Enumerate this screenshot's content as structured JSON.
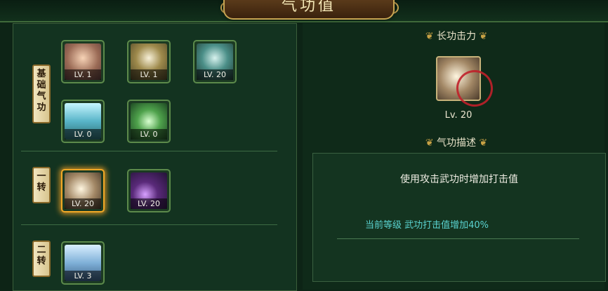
{
  "window": {
    "title": "气功值"
  },
  "rows": [
    {
      "label": [
        "基",
        "础",
        "气",
        "功"
      ]
    },
    {
      "label": [
        "一",
        "转"
      ]
    },
    {
      "label": [
        "二",
        "转"
      ]
    }
  ],
  "skills": [
    {
      "lv": "LV. 1",
      "icon": "body-aura-icon"
    },
    {
      "lv": "LV. 1",
      "icon": "golden-orb-icon"
    },
    {
      "lv": "LV. 20",
      "icon": "jade-statue-icon"
    },
    {
      "lv": "LV. 0",
      "icon": "light-beam-icon"
    },
    {
      "lv": "LV. 0",
      "icon": "green-dots-icon"
    },
    {
      "lv": "LV. 20",
      "icon": "sword-slash-icon"
    },
    {
      "lv": "LV. 20",
      "icon": "purple-orb-icon"
    },
    {
      "lv": "LV. 3",
      "icon": "white-haired-hero-icon"
    }
  ],
  "detail": {
    "name": "长功击力",
    "level": "Lv. 20",
    "desc_title": "气功描述",
    "description": "使用攻击武功时增加打击值",
    "current": "当前等级  武功打击值增加40%"
  },
  "colors": {
    "accent": "#c8a245",
    "active_glow": "#f1a826",
    "highlight_text": "#5ad3d0"
  }
}
